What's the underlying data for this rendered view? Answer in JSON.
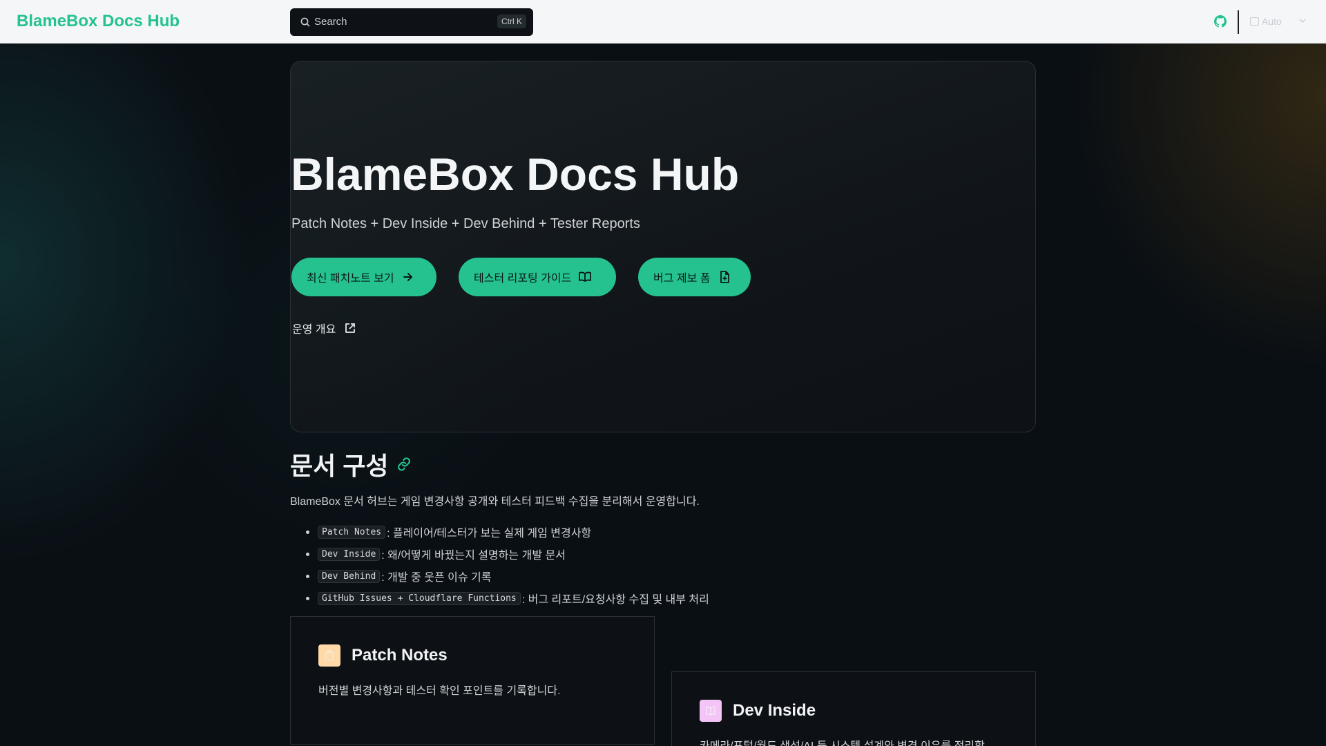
{
  "header": {
    "brand": "BlameBox Docs Hub",
    "search_placeholder": "Search",
    "search_shortcut": "Ctrl K",
    "theme_label": "Auto"
  },
  "hero": {
    "title": "BlameBox Docs Hub",
    "subtitle": "Patch Notes + Dev Inside + Dev Behind + Tester Reports",
    "buttons": [
      {
        "label": "최신 패치노트 보기",
        "icon": "arrow-right-icon"
      },
      {
        "label": "테스터 리포팅 가이드",
        "icon": "book-open-icon"
      },
      {
        "label": "버그 제보 폼",
        "icon": "file-plus-icon"
      }
    ],
    "ops_link": "운영 개요"
  },
  "section": {
    "title": "문서 구성",
    "description": "BlameBox 문서 허브는 게임 변경사항 공개와 테스터 피드백 수집을 분리해서 운영합니다.",
    "items": [
      {
        "code": "Patch Notes",
        "text": ": 플레이어/테스터가 보는 실제 게임 변경사항"
      },
      {
        "code": "Dev Inside",
        "text": ": 왜/어떻게 바꿨는지 설명하는 개발 문서"
      },
      {
        "code": "Dev Behind",
        "text": ": 개발 중 웃픈 이슈 기록"
      },
      {
        "code": "GitHub Issues + Cloudflare Functions",
        "text": ": 버그 리포트/요청사항 수집 및 내부 처리"
      }
    ]
  },
  "cards": [
    {
      "title": "Patch Notes",
      "description": "버전별 변경사항과 테스터 확인 포인트를 기록합니다."
    },
    {
      "title": "Dev Inside",
      "description": "카메라/포털/월드 생성/AI 등 시스템 설계와 변경 이유를 정리합"
    }
  ],
  "colors": {
    "accent": "#25c290",
    "background": "#0a0f14",
    "header_bg": "#f4f6f8"
  }
}
